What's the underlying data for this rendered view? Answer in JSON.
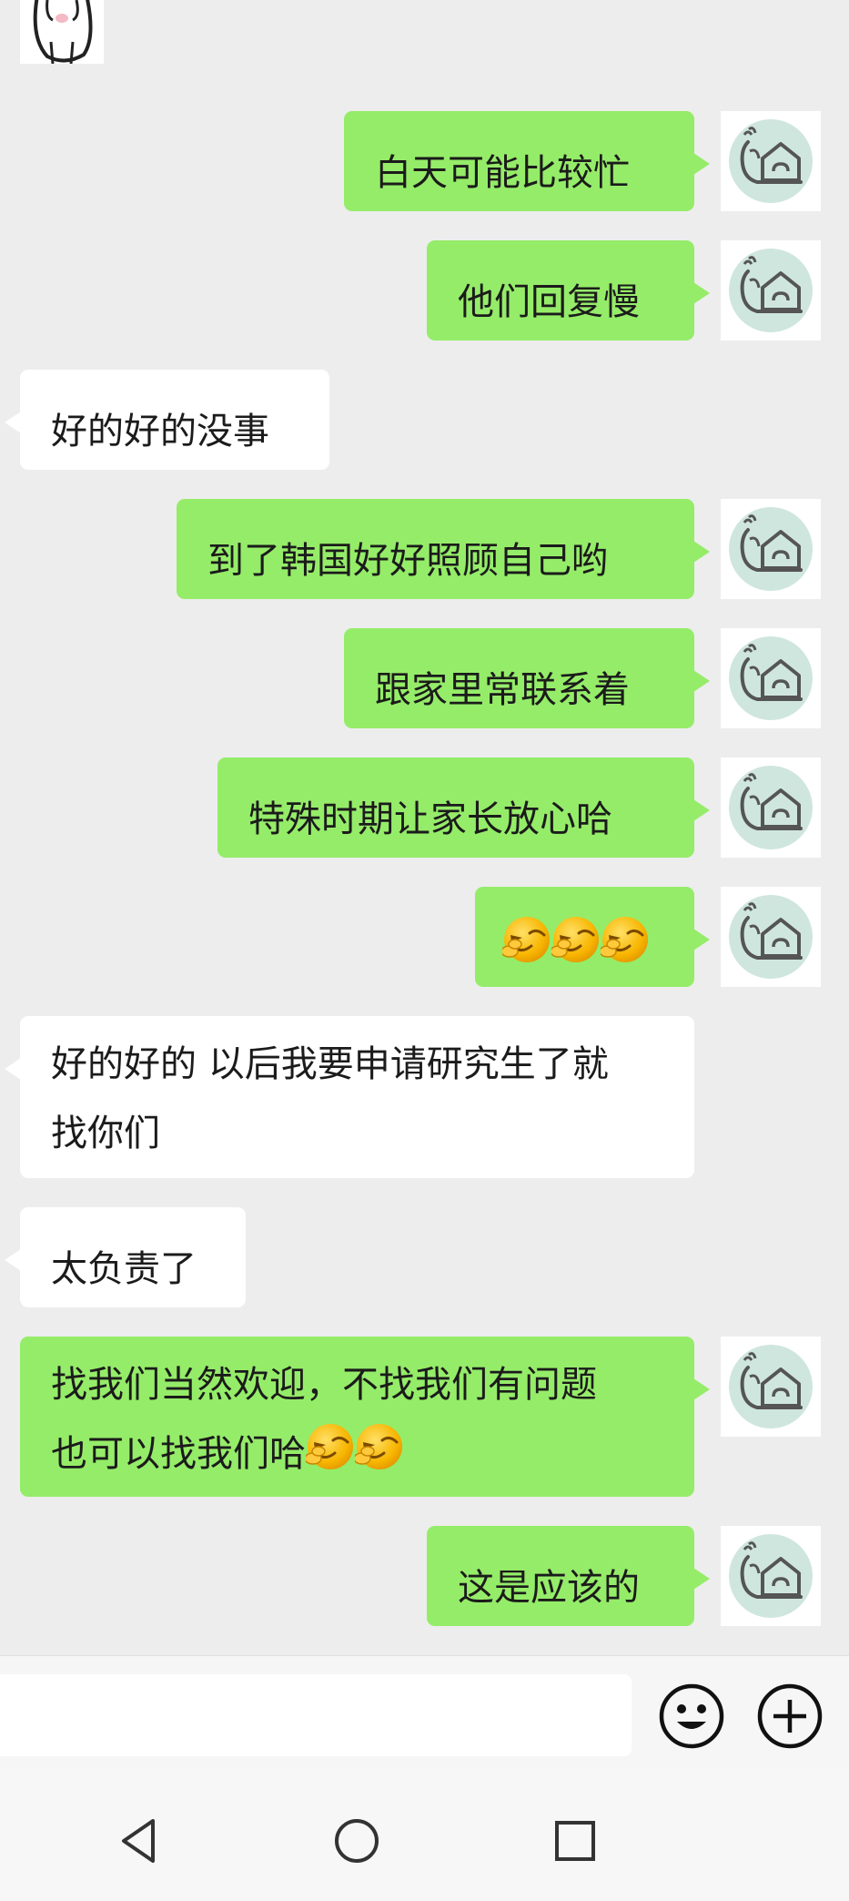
{
  "messages": [
    {
      "side": "out",
      "text": "白天可能比较忙"
    },
    {
      "side": "out",
      "text": "他们回复慢"
    },
    {
      "side": "in",
      "text": "好的好的没事"
    },
    {
      "side": "out",
      "text": "到了韩国好好照顾自己哟"
    },
    {
      "side": "out",
      "text": "跟家里常联系着"
    },
    {
      "side": "out",
      "text": "特殊时期让家长放心哈"
    },
    {
      "side": "out",
      "emoji": [
        "wink-emoji",
        "wink-emoji",
        "wink-emoji"
      ]
    },
    {
      "side": "in",
      "line1": "好的好的 以后我要申请研究生了就",
      "line2": "找你们"
    },
    {
      "side": "in",
      "text": "太负责了"
    },
    {
      "side": "out",
      "line1": "找我们当然欢迎，不找我们有问题",
      "line2": "也可以找我们哈",
      "emoji": [
        "wink-emoji",
        "wink-emoji"
      ]
    },
    {
      "side": "out",
      "text": "这是应该的"
    }
  ],
  "colors": {
    "outgoing_bubble": "#95ec69",
    "incoming_bubble": "#ffffff",
    "chat_background": "#ededed"
  },
  "input": {
    "value": "",
    "placeholder": ""
  },
  "icons": {
    "emoji_button": "smiley-icon",
    "more_button": "plus-circle-icon",
    "nav_back": "triangle-back-icon",
    "nav_home": "circle-home-icon",
    "nav_recents": "square-recents-icon",
    "avatar": "snail-house-avatar"
  }
}
